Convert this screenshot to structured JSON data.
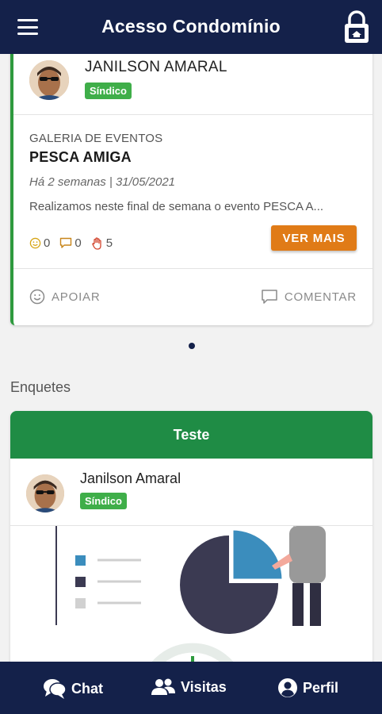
{
  "header": {
    "title": "Acesso Condomínio"
  },
  "post": {
    "author": "JANILSON AMARAL",
    "badge": "Síndico",
    "category": "GALERIA DE EVENTOS",
    "title": "PESCA AMIGA",
    "date": "Há 2 semanas | 31/05/2021",
    "excerpt": "Realizamos neste final de semana o evento PESCA A...",
    "reactions": {
      "smile": "0",
      "comment": "0",
      "like": "5"
    },
    "more_label": "VER MAIS",
    "support_label": "APOIAR",
    "comment_label": "COMENTAR"
  },
  "polls": {
    "section_title": "Enquetes",
    "title": "Teste",
    "author": "Janilson Amaral",
    "badge": "Síndico"
  },
  "nav": {
    "chat": "Chat",
    "visitas": "Visitas",
    "perfil": "Perfil"
  },
  "colors": {
    "header": "#14214a",
    "accent_green": "#1f8c45",
    "badge_green": "#3fae49",
    "orange": "#e07b17"
  }
}
